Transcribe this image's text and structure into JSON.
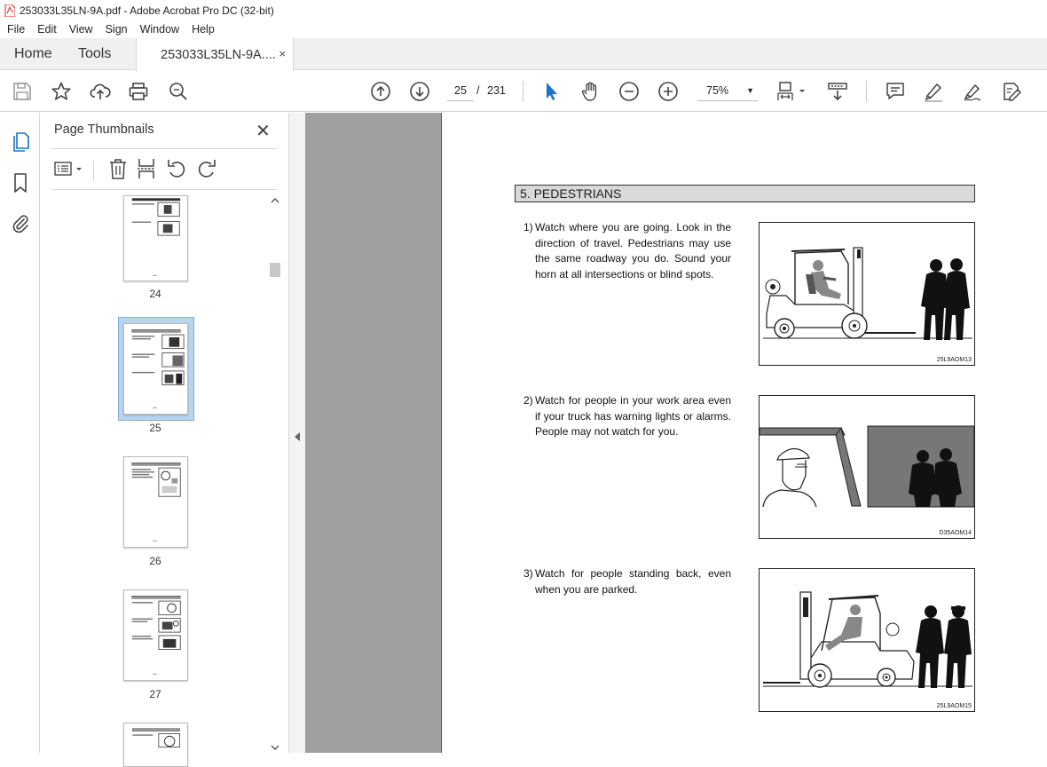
{
  "window": {
    "title": "253033L35LN-9A.pdf - Adobe Acrobat Pro DC (32-bit)"
  },
  "menu": [
    "File",
    "Edit",
    "View",
    "Sign",
    "Window",
    "Help"
  ],
  "tabs": {
    "home": "Home",
    "tools": "Tools",
    "document": "253033L35LN-9A....",
    "close": "×"
  },
  "toolbar": {
    "current_page": "25",
    "page_separator": "/",
    "total_pages": "231",
    "zoom": "75%",
    "zoom_caret": "▼"
  },
  "thumbnails_pane": {
    "title": "Page Thumbnails",
    "close": "✕",
    "pages": [
      {
        "label": "24"
      },
      {
        "label": "25",
        "selected": true
      },
      {
        "label": "26"
      },
      {
        "label": "27"
      }
    ]
  },
  "document": {
    "section_heading": "5. PEDESTRIANS",
    "items": [
      {
        "number": "1)",
        "text": "Watch where you are going.  Look in the direction of travel.  Pedestrians may use the same roadway you do.  Sound your horn at all intersections or blind spots.",
        "figure_code": "25L9AOM13"
      },
      {
        "number": "2)",
        "text": "Watch for people in your work area even if your truck has warning lights or alarms. People may not watch for you.",
        "figure_code": "D35AOM14"
      },
      {
        "number": "3)",
        "text": "Watch for people standing back, even when you are parked.",
        "figure_code": "25L9AOM15"
      }
    ]
  },
  "colors": {
    "accent_blue": "#1a73c7",
    "pdf_red": "#d9261c",
    "doc_background": "#a0a0a0",
    "heading_fill": "#d9d9d9"
  }
}
